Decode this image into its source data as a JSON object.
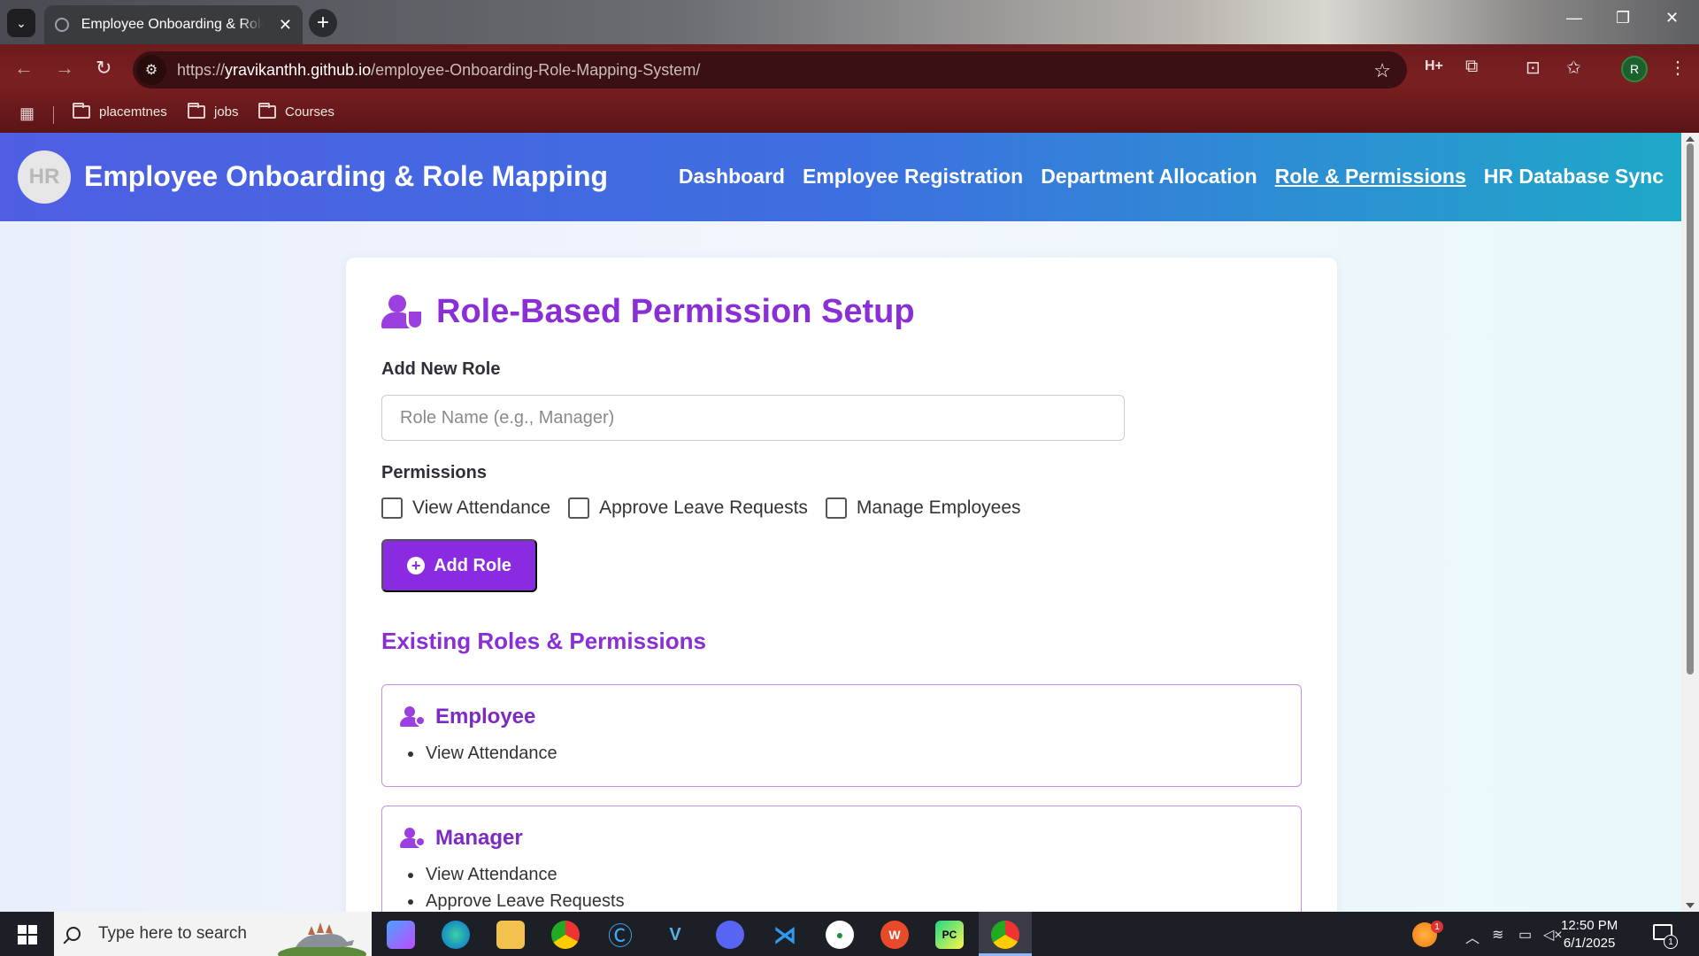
{
  "browser": {
    "tab_title": "Employee Onboarding & Role Mapping",
    "tab_close": "✕",
    "url_scheme": "https://",
    "url_host": "yravikanthh.github.io",
    "url_path": "/employee-Onboarding-Role-Mapping-System/",
    "profile_initial": "R",
    "bookmarks": [
      "placemtnes",
      "jobs",
      "Courses"
    ],
    "ext_badge": "H+"
  },
  "header": {
    "logo_text": "HR",
    "title": "Employee Onboarding & Role Mapping",
    "nav": [
      {
        "label": "Dashboard",
        "active": false
      },
      {
        "label": "Employee Registration",
        "active": false
      },
      {
        "label": "Department Allocation",
        "active": false
      },
      {
        "label": "Role & Permissions",
        "active": true
      },
      {
        "label": "HR Database Sync",
        "active": false
      }
    ]
  },
  "main": {
    "title": "Role-Based Permission Setup",
    "add_role_label": "Add New Role",
    "role_input_placeholder": "Role Name (e.g., Manager)",
    "role_input_value": "",
    "permissions_label": "Permissions",
    "permissions": [
      {
        "label": "View Attendance",
        "checked": false
      },
      {
        "label": "Approve Leave Requests",
        "checked": false
      },
      {
        "label": "Manage Employees",
        "checked": false
      }
    ],
    "add_role_button": "Add Role",
    "existing_title": "Existing Roles & Permissions",
    "roles": [
      {
        "name": "Employee",
        "permissions": [
          "View Attendance"
        ]
      },
      {
        "name": "Manager",
        "permissions": [
          "View Attendance",
          "Approve Leave Requests"
        ]
      }
    ]
  },
  "taskbar": {
    "search_placeholder": "Type here to search",
    "time": "12:50 PM",
    "date": "6/1/2025",
    "notification_count": "1",
    "weather_badge": "1"
  },
  "colors": {
    "accent": "#8a2be2",
    "header_start": "#4f5ee3",
    "header_end": "#1fa8c8"
  },
  "icons": [
    "search-icon",
    "user-shield-icon",
    "user-gear-icon",
    "plus-circle-icon",
    "star-icon",
    "folder-icon",
    "apps-grid-icon"
  ]
}
